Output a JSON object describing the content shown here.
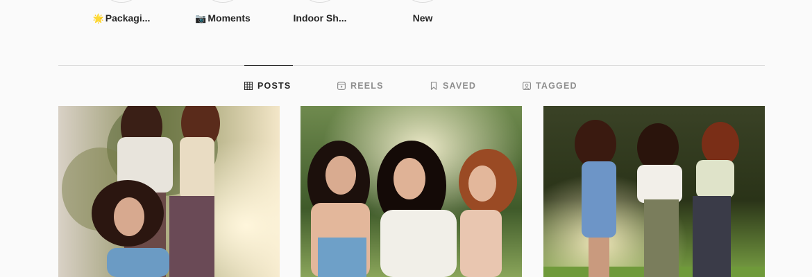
{
  "highlights": [
    {
      "emoji": "🌟",
      "label": "Packagi..."
    },
    {
      "emoji": "📷",
      "label": "Moments"
    },
    {
      "emoji": "",
      "label": "Indoor Sh..."
    },
    {
      "emoji": "",
      "label": "New"
    }
  ],
  "tabs": {
    "posts": "POSTS",
    "reels": "REELS",
    "saved": "SAVED",
    "tagged": "TAGGED"
  },
  "icons": {
    "posts": "grid-icon",
    "reels": "reels-icon",
    "saved": "bookmark-icon",
    "tagged": "tagged-user-icon"
  },
  "colors": {
    "active_tab": "#262626",
    "inactive_tab": "#8e8e8e",
    "divider": "#dbdbdb",
    "background": "#fafafa"
  }
}
